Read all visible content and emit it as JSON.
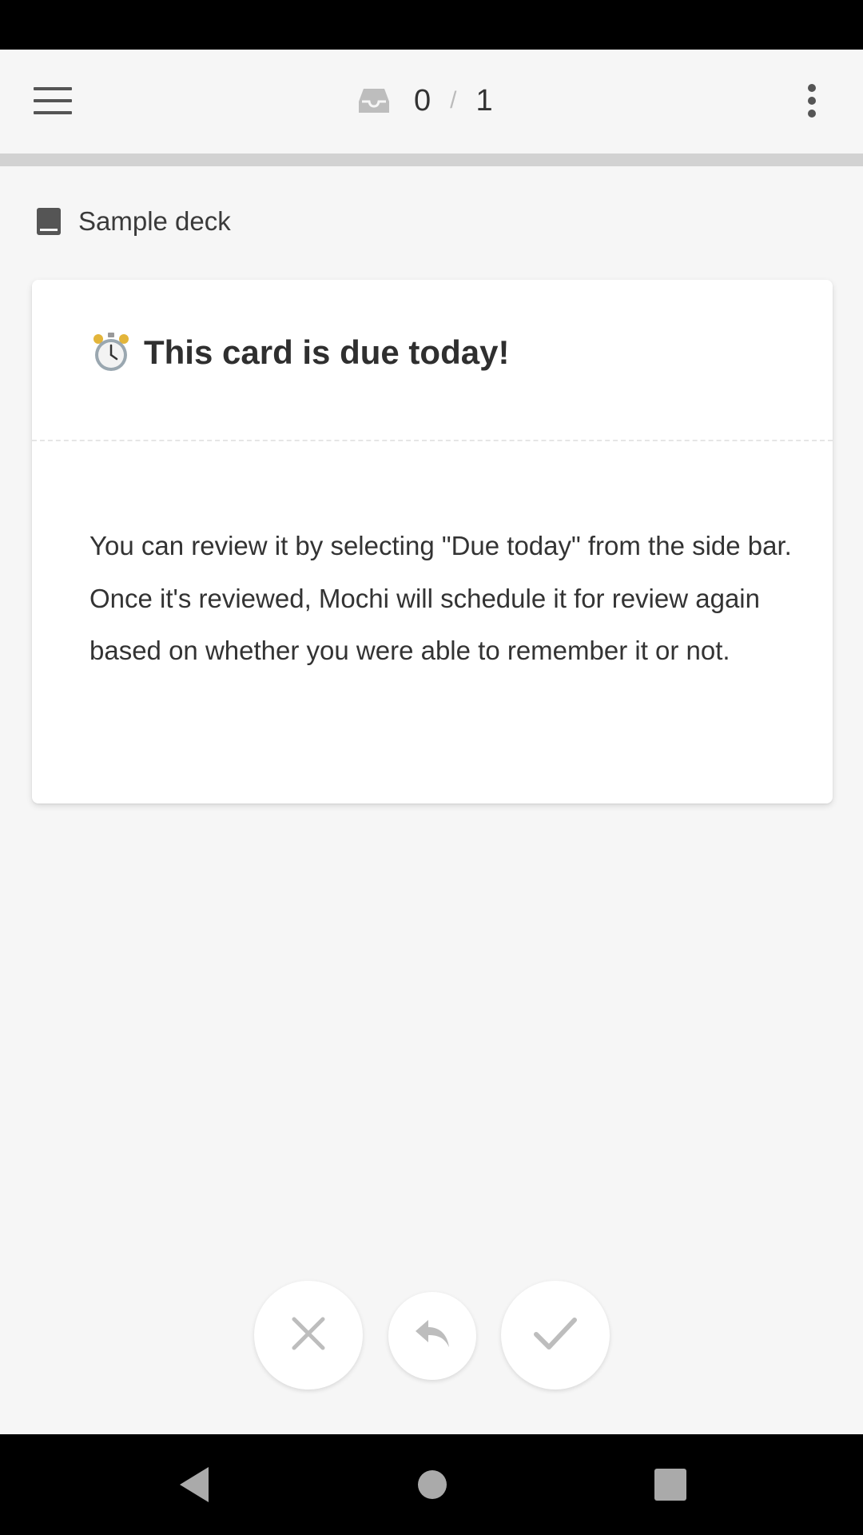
{
  "app_bar": {
    "menu_icon": "hamburger-menu-icon",
    "inbox_icon": "inbox-icon",
    "counter_current": "0",
    "counter_separator": "/",
    "counter_total": "1",
    "more_icon": "more-vertical-icon"
  },
  "progress": {
    "fraction": 0
  },
  "deck": {
    "icon": "book-icon",
    "name": "Sample deck"
  },
  "card": {
    "title_icon": "alarm-clock-icon",
    "title": "This card is due today!",
    "body": "You can review it by selecting \"Due today\" from the side bar. Once it's reviewed, Mochi will schedule it for review again based on whether you were able to remember it or not."
  },
  "actions": {
    "forgot_icon": "close-icon",
    "undo_icon": "undo-icon",
    "remember_icon": "check-icon"
  },
  "colors": {
    "background": "#f6f6f6",
    "card": "#ffffff",
    "text": "#333333",
    "icon_gray": "#bdbdbd",
    "system_bar": "#000000"
  }
}
